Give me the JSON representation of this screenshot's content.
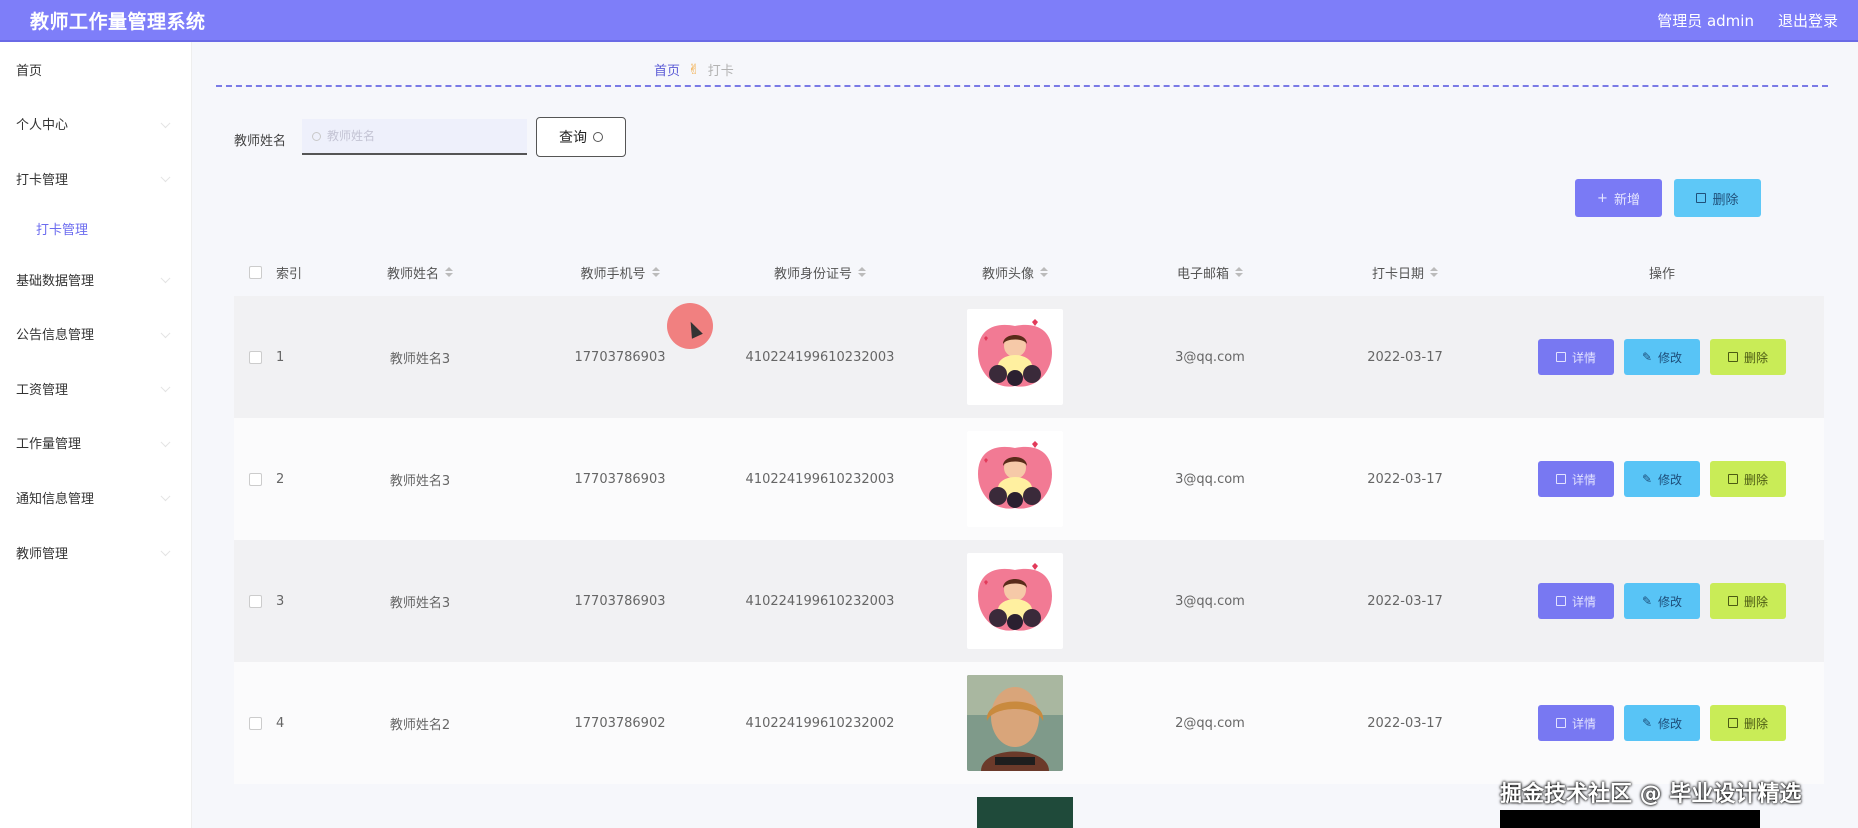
{
  "header": {
    "title": "教师工作量管理系统",
    "user_label": "管理员 admin",
    "logout_label": "退出登录"
  },
  "sidebar": {
    "items": [
      {
        "label": "首页"
      },
      {
        "label": "个人中心"
      },
      {
        "label": "打卡管理"
      },
      {
        "label": "打卡管理"
      },
      {
        "label": "基础数据管理"
      },
      {
        "label": "公告信息管理"
      },
      {
        "label": "工资管理"
      },
      {
        "label": "工作量管理"
      },
      {
        "label": "通知信息管理"
      },
      {
        "label": "教师管理"
      }
    ]
  },
  "breadcrumb": {
    "home": "首页",
    "current": "打卡"
  },
  "search": {
    "label": "教师姓名",
    "placeholder": "教师姓名",
    "query_label": "查询"
  },
  "toolbar": {
    "add_label": "新增",
    "delete_label": "删除"
  },
  "table": {
    "columns": [
      "索引",
      "教师姓名",
      "教师手机号",
      "教师身份证号",
      "教师头像",
      "电子邮箱",
      "打卡日期",
      "操作"
    ],
    "rows": [
      {
        "index": "1",
        "name": "教师姓名3",
        "phone": "17703786903",
        "id_number": "410224199610232003",
        "email": "3@qq.com",
        "date": "2022-03-17",
        "avatar": "cartoon-avatar"
      },
      {
        "index": "2",
        "name": "教师姓名3",
        "phone": "17703786903",
        "id_number": "410224199610232003",
        "email": "3@qq.com",
        "date": "2022-03-17",
        "avatar": "cartoon-avatar"
      },
      {
        "index": "3",
        "name": "教师姓名3",
        "phone": "17703786903",
        "id_number": "410224199610232003",
        "email": "3@qq.com",
        "date": "2022-03-17",
        "avatar": "cartoon-avatar"
      },
      {
        "index": "4",
        "name": "教师姓名2",
        "phone": "17703786902",
        "id_number": "410224199610232002",
        "email": "2@qq.com",
        "date": "2022-03-17",
        "avatar": "photo-avatar"
      }
    ],
    "actions": {
      "detail": "详情",
      "edit": "修改",
      "delete": "删除"
    }
  },
  "watermark": "掘金技术社区 @ 毕业设计精选",
  "colors": {
    "header": "#7e7ef9",
    "detail_button": "#7878f2",
    "edit_button": "#58c4f6",
    "delete_button": "#c9ec57"
  }
}
